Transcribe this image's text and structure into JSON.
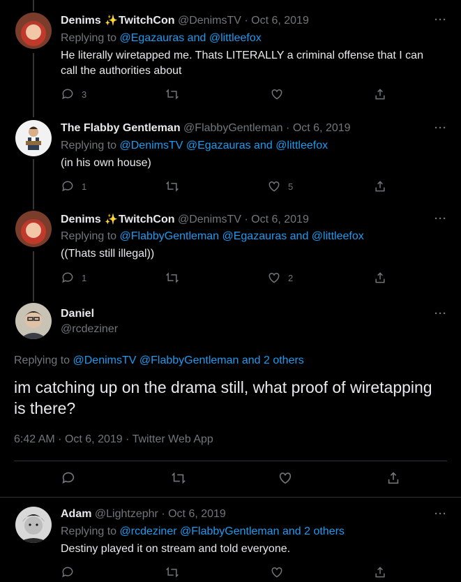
{
  "tweets": [
    {
      "name": "Denims",
      "name_suffix": "TwitchCon",
      "badge_icon": "sparkles-emoji",
      "handle": "@DenimsTV",
      "date": "Oct 6, 2019",
      "replying_prefix": "Replying to ",
      "replying_mentions": "@Egazauras and @littleefox",
      "text": "He literally wiretapped me. Thats LITERALLY a criminal offense that I can call the authorities about",
      "replies": "3",
      "retweets": "",
      "likes": ""
    },
    {
      "name": "The Flabby Gentleman",
      "handle": "@FlabbyGentleman",
      "date": "Oct 6, 2019",
      "replying_prefix": "Replying to ",
      "replying_mentions": "@DenimsTV @Egazauras and @littleefox",
      "text": "(in his own house)",
      "replies": "1",
      "retweets": "",
      "likes": "5"
    },
    {
      "name": "Denims",
      "name_suffix": "TwitchCon",
      "badge_icon": "sparkles-emoji",
      "handle": "@DenimsTV",
      "date": "Oct 6, 2019",
      "replying_prefix": "Replying to ",
      "replying_mentions": "@FlabbyGentleman @Egazauras and @littleefox",
      "text": "((Thats still illegal))",
      "replies": "1",
      "retweets": "",
      "likes": "2"
    }
  ],
  "main_tweet": {
    "name": "Daniel",
    "handle": "@rcdeziner",
    "replying_prefix": "Replying to ",
    "replying_mentions": "@DenimsTV @FlabbyGentleman and 2 others",
    "text": "im catching up on the drama still, what proof of wiretapping is there?",
    "time": "6:42 AM",
    "date": "Oct 6, 2019",
    "source": "Twitter Web App"
  },
  "reply_tweet": {
    "name": "Adam",
    "handle": "@Lightzephr",
    "date": "Oct 6, 2019",
    "replying_prefix": "Replying to ",
    "replying_mentions": "@rcdeziner @FlabbyGentleman and 2 others",
    "text": "Destiny played it on stream and told everyone."
  },
  "separator": "·",
  "more_label": "···",
  "colors": {
    "background": "#000000",
    "text": "#e7e9ea",
    "secondary": "#71767b",
    "link": "#1d9bf0",
    "divider": "#2f3336"
  },
  "icons": [
    "reply-icon",
    "retweet-icon",
    "like-icon",
    "share-icon",
    "more-icon"
  ]
}
